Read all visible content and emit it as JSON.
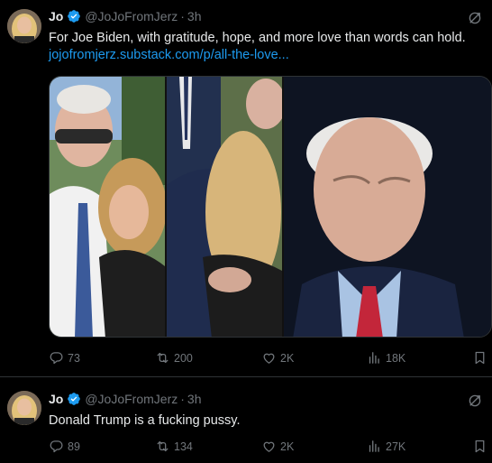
{
  "tweets": [
    {
      "display_name": "Jo",
      "handle": "@JoJoFromJerz",
      "separator": "·",
      "time": "3h",
      "text": "For Joe Biden, with gratitude, hope, and more love than words can hold.",
      "link": "jojofromjerz.substack.com/p/all-the-love...",
      "stats": {
        "replies": "73",
        "retweets": "200",
        "likes": "2K",
        "views": "18K"
      }
    },
    {
      "display_name": "Jo",
      "handle": "@JoJoFromJerz",
      "separator": "·",
      "time": "3h",
      "text": "Donald Trump is a fucking pussy.",
      "stats": {
        "replies": "89",
        "retweets": "134",
        "likes": "2K",
        "views": "27K"
      }
    }
  ],
  "colors": {
    "background": "#000000",
    "text": "#e7e9ea",
    "muted": "#71767b",
    "link": "#1d9bf0",
    "verified": "#1d9bf0",
    "border": "#2f3336"
  },
  "icons": [
    "verified-badge-icon",
    "grok-icon",
    "reply-icon",
    "retweet-icon",
    "like-icon",
    "views-icon",
    "bookmark-icon"
  ]
}
